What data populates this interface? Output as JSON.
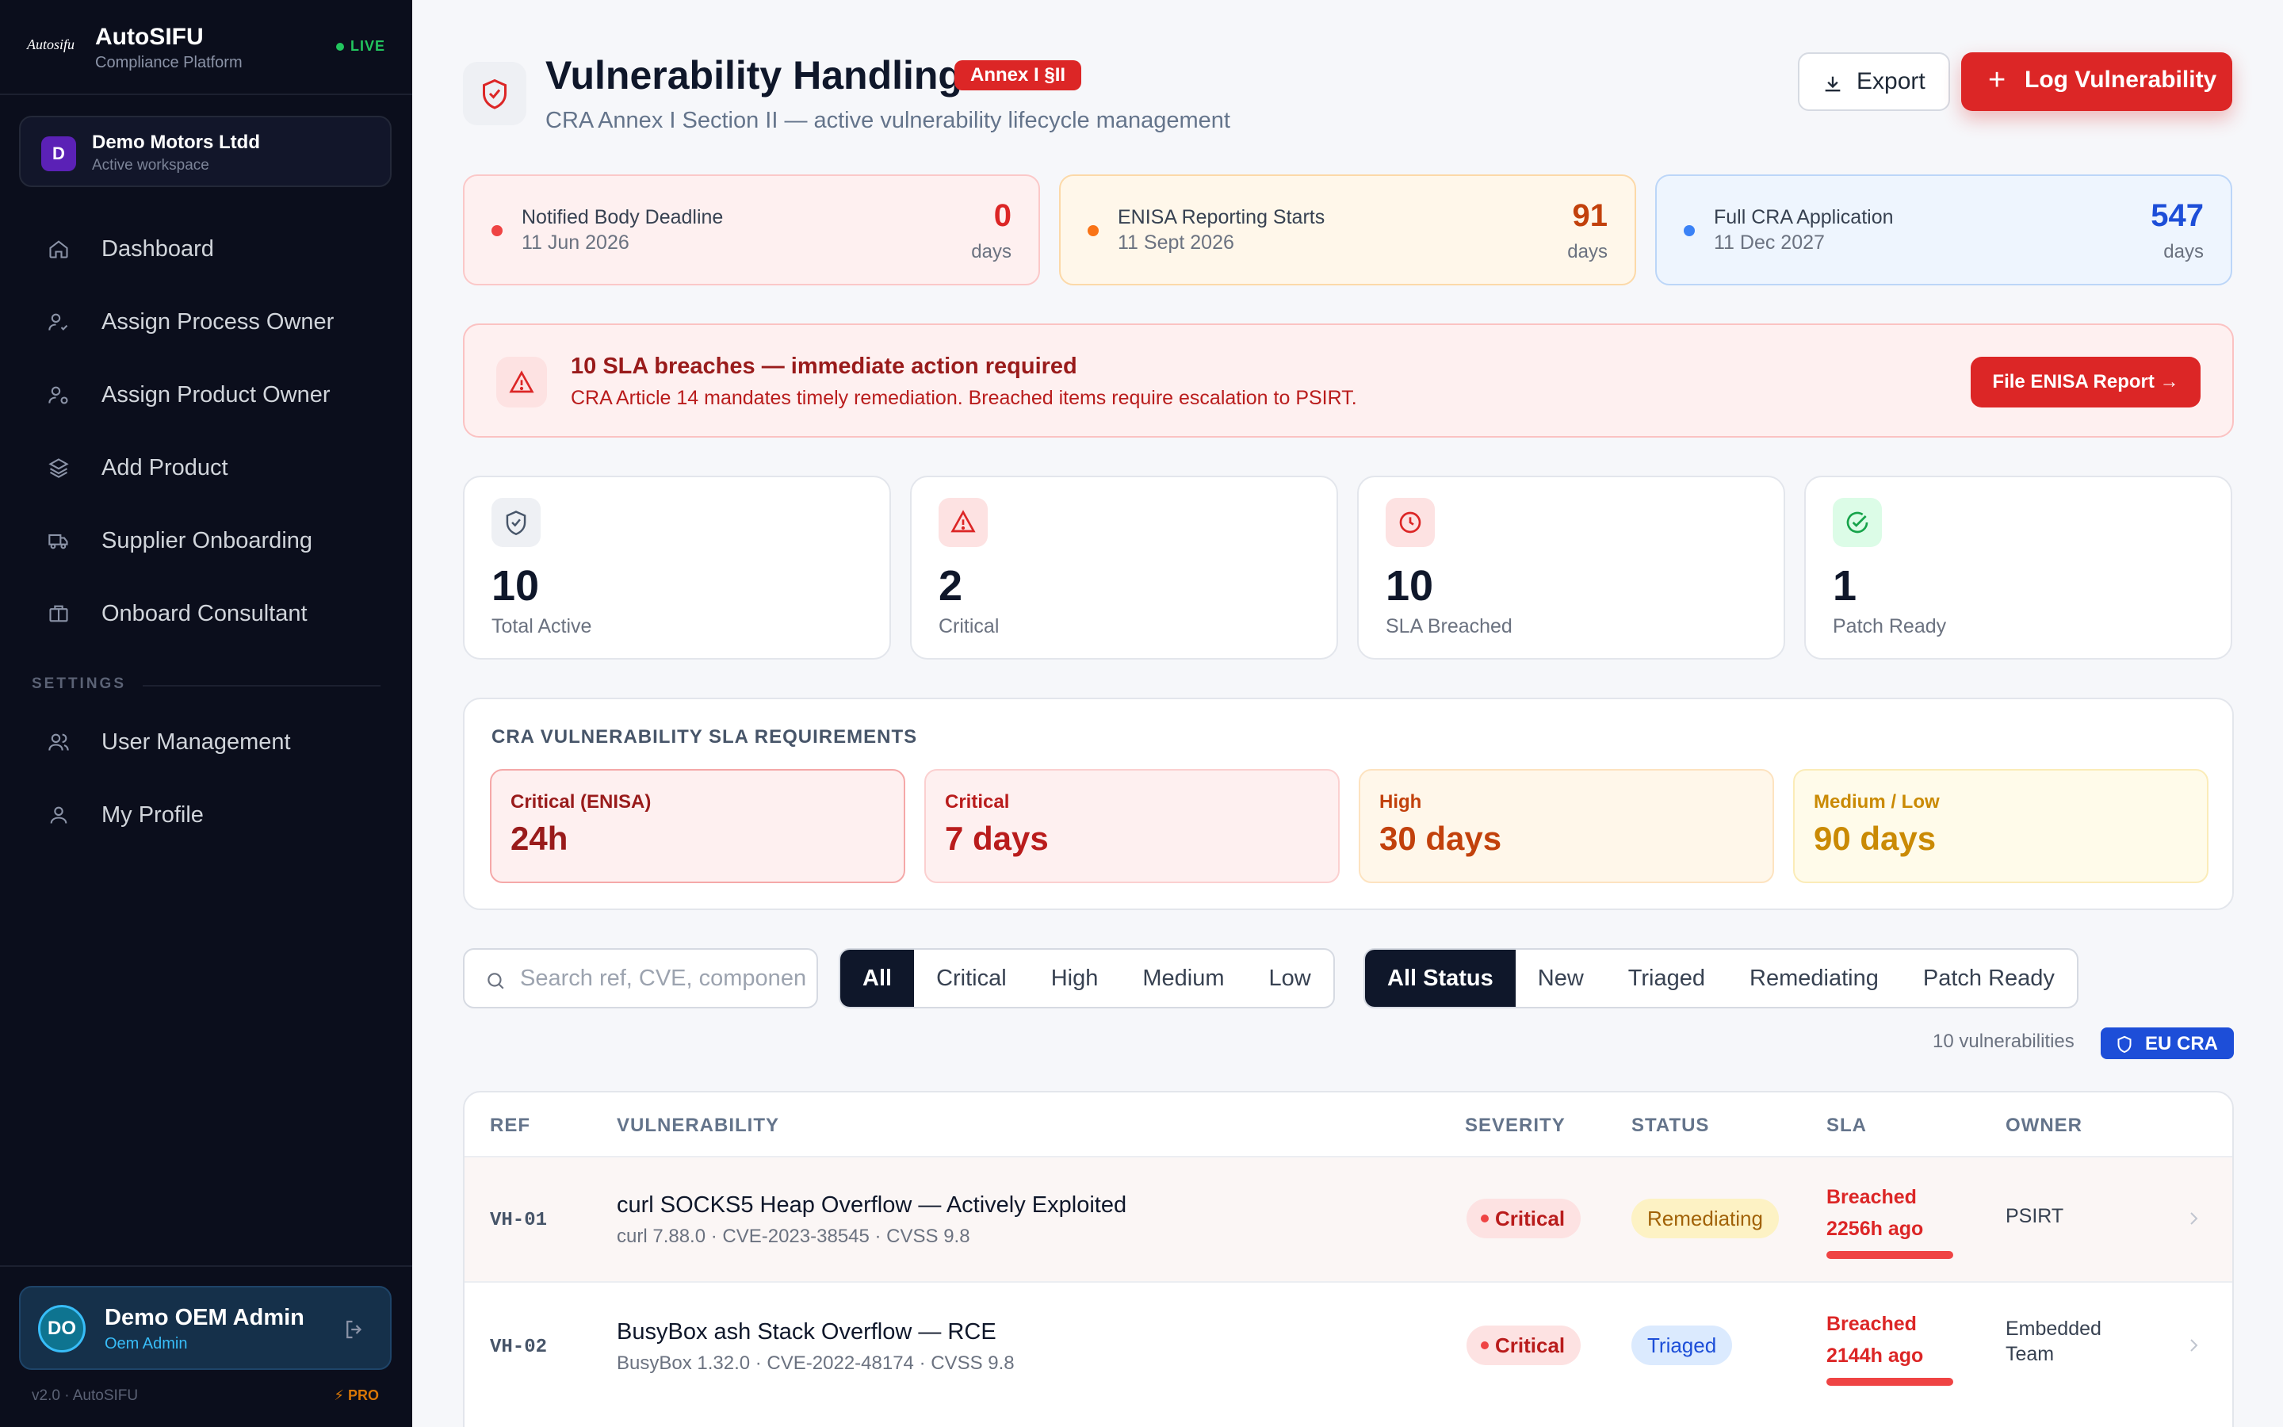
{
  "sidebar": {
    "brand_logo": "Autosifu",
    "brand_name": "AutoSIFU",
    "brand_sub": "Compliance Platform",
    "live": "LIVE",
    "workspace": {
      "initial": "D",
      "name": "Demo Motors Ltdd",
      "sub": "Active workspace"
    },
    "nav": [
      {
        "label": "Dashboard",
        "icon": "home-icon"
      },
      {
        "label": "Assign Process Owner",
        "icon": "user-check-icon"
      },
      {
        "label": "Assign Product Owner",
        "icon": "user-cog-icon"
      },
      {
        "label": "Add Product",
        "icon": "layers-icon"
      },
      {
        "label": "Supplier Onboarding",
        "icon": "truck-icon"
      },
      {
        "label": "Onboard Consultant",
        "icon": "briefcase-icon"
      }
    ],
    "settings_label": "SETTINGS",
    "settings_nav": [
      {
        "label": "User Management",
        "icon": "users-icon"
      },
      {
        "label": "My Profile",
        "icon": "user-icon"
      }
    ],
    "user": {
      "initials": "DO",
      "name": "Demo OEM Admin",
      "role": "Oem Admin"
    },
    "version": "v2.0 · AutoSIFU",
    "pro": "PRO"
  },
  "header": {
    "title": "Vulnerability Handling",
    "badge": "Annex I §II",
    "subtitle": "CRA Annex I Section II — active vulnerability lifecycle management",
    "export_label": "Export",
    "log_label": "Log Vulnerability"
  },
  "deadlines": [
    {
      "title": "Notified Body Deadline",
      "date": "11 Jun 2026",
      "value": "0",
      "unit": "days",
      "color": "#ef4444"
    },
    {
      "title": "ENISA Reporting Starts",
      "date": "11 Sept 2026",
      "value": "91",
      "unit": "days",
      "color": "#f97316"
    },
    {
      "title": "Full CRA Application",
      "date": "11 Dec 2027",
      "value": "547",
      "unit": "days",
      "color": "#3b82f6"
    }
  ],
  "alert": {
    "title": "10 SLA breaches — immediate action required",
    "subtitle": "CRA Article 14 mandates timely remediation. Breached items require escalation to PSIRT.",
    "button": "File ENISA Report →"
  },
  "stats": [
    {
      "value": "10",
      "label": "Total Active",
      "icon": "shield-icon"
    },
    {
      "value": "2",
      "label": "Critical",
      "icon": "alert-triangle-icon"
    },
    {
      "value": "10",
      "label": "SLA Breached",
      "icon": "clock-icon"
    },
    {
      "value": "1",
      "label": "Patch Ready",
      "icon": "check-circle-icon"
    }
  ],
  "sla": {
    "title": "CRA VULNERABILITY SLA REQUIREMENTS",
    "items": [
      {
        "label": "Critical (ENISA)",
        "value": "24h"
      },
      {
        "label": "Critical",
        "value": "7 days"
      },
      {
        "label": "High",
        "value": "30 days"
      },
      {
        "label": "Medium / Low",
        "value": "90 days"
      }
    ]
  },
  "filters": {
    "search_placeholder": "Search ref, CVE, component...",
    "severity": [
      "All",
      "Critical",
      "High",
      "Medium",
      "Low"
    ],
    "status": [
      "All Status",
      "New",
      "Triaged",
      "Remediating",
      "Patch Ready"
    ],
    "count": "10 vulnerabilities",
    "cra_badge": "EU CRA"
  },
  "table": {
    "columns": [
      "REF",
      "VULNERABILITY",
      "SEVERITY",
      "STATUS",
      "SLA",
      "OWNER"
    ],
    "rows": [
      {
        "ref": "VH-01",
        "title": "curl SOCKS5 Heap Overflow — Actively Exploited",
        "sub": "curl 7.88.0 · CVE-2023-38545 · CVSS 9.8",
        "severity": "Critical",
        "status": "Remediating",
        "sla_line1": "Breached",
        "sla_line2": "2256h ago",
        "owner": "PSIRT"
      },
      {
        "ref": "VH-02",
        "title": "BusyBox ash Stack Overflow — RCE",
        "sub": "BusyBox 1.32.0 · CVE-2022-48174 · CVSS 9.8",
        "severity": "Critical",
        "status": "Triaged",
        "sla_line1": "Breached",
        "sla_line2": "2144h ago",
        "owner": "Embedded Team"
      }
    ]
  }
}
